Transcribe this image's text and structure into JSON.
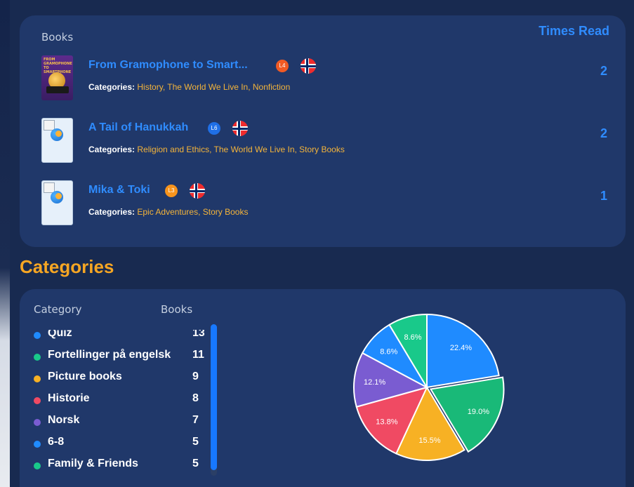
{
  "books_panel": {
    "header_books": "Books",
    "header_times": "Times Read",
    "categories_label": "Categories:",
    "rows": [
      {
        "title": "From Gramophone to Smart...",
        "level": "L4",
        "level_color": "#f15a24",
        "categories": "History, The World We Live In, Nonfiction",
        "times_read": "2",
        "cover_text": "FROM GRAMOPHONE TO SMARTPHONE"
      },
      {
        "title": "A Tail of Hanukkah",
        "level": "L6",
        "level_color": "#1f6fe6",
        "categories": "Religion and Ethics, The World We Live In, Story Books",
        "times_read": "2"
      },
      {
        "title": "Mika & Toki",
        "level": "L3",
        "level_color": "#f7941d",
        "categories": "Epic Adventures, Story Books",
        "times_read": "1"
      }
    ]
  },
  "categories_section": {
    "title": "Categories",
    "header_category": "Category",
    "header_books": "Books",
    "legend": [
      {
        "name": "Quiz",
        "count": "13",
        "color": "#1f8bff"
      },
      {
        "name": "Fortellinger på engelsk",
        "count": "11",
        "color": "#19c98a"
      },
      {
        "name": "Picture books",
        "count": "9",
        "color": "#f7b124"
      },
      {
        "name": "Historie",
        "count": "8",
        "color": "#f04a63"
      },
      {
        "name": "Norsk",
        "count": "7",
        "color": "#7a5cd1"
      },
      {
        "name": "6-8",
        "count": "5",
        "color": "#1f8bff"
      },
      {
        "name": "Family & Friends",
        "count": "5",
        "color": "#19c98a"
      }
    ]
  },
  "chart_data": {
    "type": "pie",
    "slices": [
      {
        "label": "22.4%",
        "value": 22.4,
        "color": "#1f8bff"
      },
      {
        "label": "19.0%",
        "value": 19.0,
        "color": "#19b978"
      },
      {
        "label": "15.5%",
        "value": 15.5,
        "color": "#f7b124"
      },
      {
        "label": "13.8%",
        "value": 13.8,
        "color": "#f04a63"
      },
      {
        "label": "12.1%",
        "value": 12.1,
        "color": "#7a5cd1"
      },
      {
        "label": "8.6%",
        "value": 8.6,
        "color": "#1f8bff"
      },
      {
        "label": "8.6%",
        "value": 8.6,
        "color": "#19c98a"
      }
    ]
  }
}
